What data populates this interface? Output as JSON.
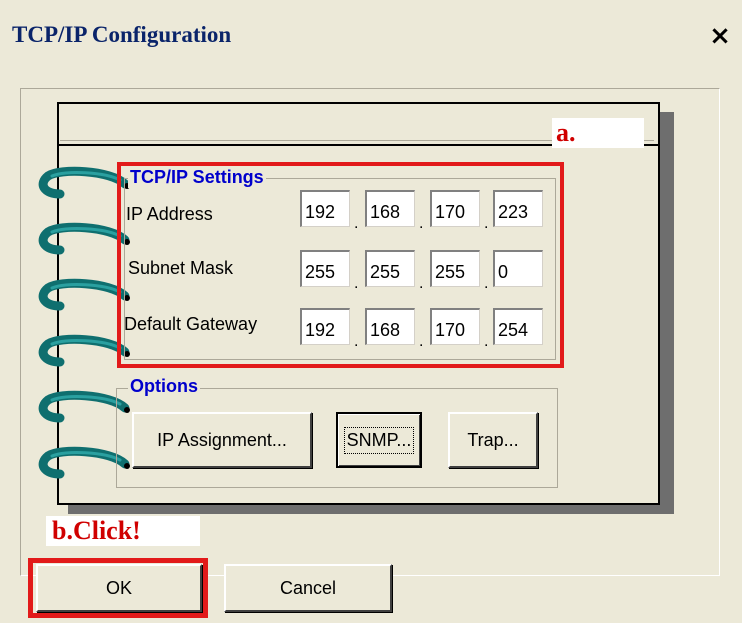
{
  "window": {
    "title": "TCP/IP Configuration",
    "close_glyph": "×"
  },
  "annotations": {
    "a": "a.",
    "b": "b.Click!"
  },
  "tcpip": {
    "group_title": "TCP/IP Settings",
    "rows": [
      {
        "label": "IP Address",
        "octets": [
          "192",
          "168",
          "170",
          "223"
        ]
      },
      {
        "label": "Subnet Mask",
        "octets": [
          "255",
          "255",
          "255",
          "0"
        ]
      },
      {
        "label": "Default Gateway",
        "octets": [
          "192",
          "168",
          "170",
          "254"
        ]
      }
    ],
    "separator": "."
  },
  "options": {
    "group_title": "Options",
    "ip_assignment_label": "IP Assignment...",
    "snmp_label": "SNMP...",
    "trap_label": "Trap..."
  },
  "footer": {
    "ok_label": "OK",
    "cancel_label": "Cancel"
  },
  "colors": {
    "title_text": "#0a246a",
    "group_title": "#0000cc",
    "annotation_red": "#e21a1a",
    "ring_teal": "#0f7f7f"
  }
}
